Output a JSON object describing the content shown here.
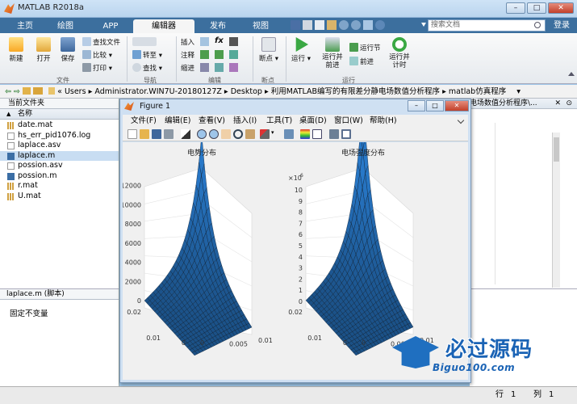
{
  "app": {
    "title": "MATLAB R2018a"
  },
  "window_controls": {
    "minimize": "–",
    "maximize": "□",
    "close": "✕"
  },
  "tabs": [
    "主页",
    "绘图",
    "APP",
    "编辑器",
    "发布",
    "视图"
  ],
  "search": {
    "placeholder": "搜索文档"
  },
  "login": "登录",
  "ribbon": {
    "new": "新建",
    "open": "打开",
    "save": "保存",
    "find_files": "查找文件",
    "compare": "比较",
    "print": "打印",
    "print_arrow": "▾",
    "compare_arrow": "▾",
    "goto": "转至",
    "find": "查找",
    "insert": "插入",
    "comment": "注释",
    "indent": "缩进",
    "fx": "fx",
    "breakpoint": "断点",
    "run": "运行",
    "run_advance": "运行并前进",
    "run_section": "运行节",
    "advance": "前进",
    "run_time": "运行并计时",
    "groups": {
      "file": "文件",
      "nav": "导航",
      "edit": "编辑",
      "breakpoints": "断点",
      "run": "运行"
    }
  },
  "address": {
    "path": [
      "«",
      "Users",
      "▸",
      "Administrator.WIN7U-20180127Z",
      "▸",
      "Desktop",
      "▸",
      "利用MATLAB编写的有限差分静电场数值分析程序",
      "▸",
      "matlab仿真程序",
      "▾"
    ]
  },
  "left_panel": {
    "title": "当前文件夹",
    "column": "名称",
    "sort": "▲",
    "files": [
      "date.mat",
      "hs_err_pid1076.log",
      "laplace.asv",
      "laplace.m",
      "possion.asv",
      "possion.m",
      "r.mat",
      "U.mat"
    ],
    "detail_title": "laplace.m  (脚本)",
    "detail_text": "固定不变量"
  },
  "right_panel": {
    "path": "电场数值分析程序\\..."
  },
  "figure": {
    "title": "Figure 1",
    "menu": [
      "文件(F)",
      "编辑(E)",
      "查看(V)",
      "插入(I)",
      "工具(T)",
      "桌面(D)",
      "窗口(W)",
      "帮助(H)"
    ],
    "plots": [
      {
        "title": "电势分布",
        "zticks": [
          "0",
          "2000",
          "4000",
          "6000",
          "8000",
          "10000",
          "12000"
        ],
        "xticks": [
          "0",
          "0.005",
          "0.01"
        ],
        "yticks": [
          "0",
          "0.01",
          "0.02"
        ]
      },
      {
        "title": "电场强度分布",
        "zmult": "×10",
        "zexp": "6",
        "zticks": [
          "0",
          "1",
          "2",
          "3",
          "4",
          "5",
          "6",
          "7",
          "8",
          "9",
          "10"
        ],
        "xticks": [
          "0",
          "0.005",
          "0.01"
        ],
        "yticks": [
          "0",
          "0.01",
          "0.02"
        ]
      }
    ]
  },
  "watermark": {
    "text": "必过源码",
    "url": "Biguo100.com"
  },
  "status": {
    "row_label": "行",
    "row": "1",
    "col_label": "列",
    "col": "1"
  },
  "colors": {
    "surface": "#3e87c6",
    "mesh": "#0b1a2a",
    "tabbar": "#3c6f9e",
    "titlebar": "#c5dcf2"
  }
}
